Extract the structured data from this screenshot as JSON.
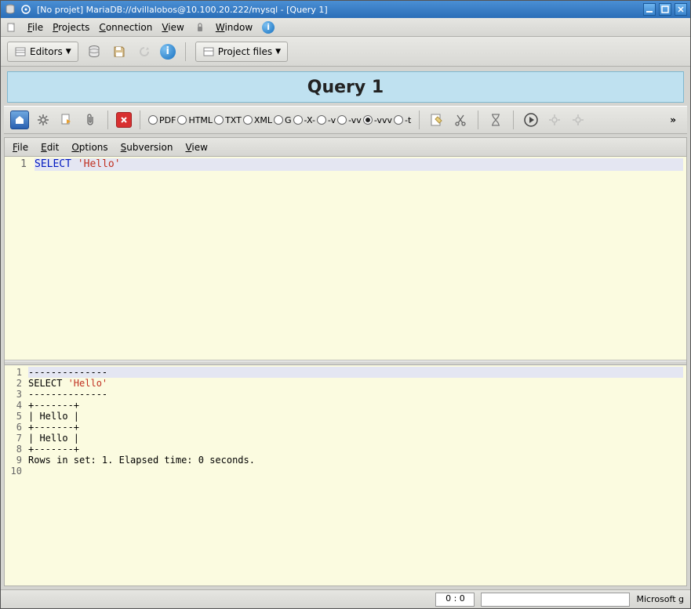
{
  "titlebar": {
    "title": "[No projet] MariaDB://dvillalobos@10.100.20.222/mysql - [Query 1]"
  },
  "menubar": {
    "file": "File",
    "projects": "Projects",
    "connection": "Connection",
    "view": "View",
    "window": "Window"
  },
  "toolbar1": {
    "editors": "Editors",
    "projectfiles": "Project files"
  },
  "queryTitle": "Query 1",
  "exportFormats": {
    "pdf": "PDF",
    "html": "HTML",
    "txt": "TXT",
    "xml": "XML",
    "g": "G",
    "x": "-X-",
    "v": "-v",
    "vv": "-vv",
    "vvv": "-vvv",
    "t": "-t",
    "selected": "-vvv"
  },
  "editMenu": {
    "file": "File",
    "edit": "Edit",
    "options": "Options",
    "subversion": "Subversion",
    "view": "View"
  },
  "editor": {
    "lines": [
      {
        "n": 1,
        "keyword": "SELECT",
        "string": "'Hello'"
      }
    ]
  },
  "output": {
    "lines": [
      {
        "n": 1,
        "text": "--------------"
      },
      {
        "n": 2,
        "prefix": "SELECT ",
        "string": "'Hello'"
      },
      {
        "n": 3,
        "text": "--------------"
      },
      {
        "n": 4,
        "text": "+-------+"
      },
      {
        "n": 5,
        "text": "| Hello |"
      },
      {
        "n": 6,
        "text": "+-------+"
      },
      {
        "n": 7,
        "text": "| Hello |"
      },
      {
        "n": 8,
        "text": "+-------+"
      },
      {
        "n": 9,
        "text": "Rows in set: 1. Elapsed time: 0 seconds."
      },
      {
        "n": 10,
        "text": ""
      }
    ]
  },
  "status": {
    "pos": "0 : 0",
    "right": "Microsoft g"
  }
}
